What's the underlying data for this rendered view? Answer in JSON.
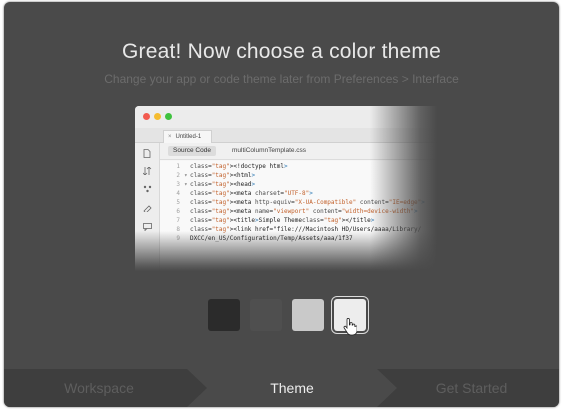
{
  "dialog": {
    "title": "Great! Now choose a color theme",
    "subtitle": "Change your app or code theme later from Preferences > Interface"
  },
  "preview": {
    "tab_close": "×",
    "tab_label": "Untitled-1",
    "source_button": "Source Code",
    "related_file": "multiColumnTemplate.css",
    "code_lines": [
      {
        "n": "1",
        "fold": "",
        "text": "<!doctype html>"
      },
      {
        "n": "2",
        "fold": "▾",
        "text": "<html>"
      },
      {
        "n": "3",
        "fold": "▾",
        "text": "<head>"
      },
      {
        "n": "4",
        "fold": "",
        "text": "<meta charset=\"UTF-8\">"
      },
      {
        "n": "5",
        "fold": "",
        "text": "<meta http-equiv=\"X-UA-Compatible\" content=\"IE=edge\">"
      },
      {
        "n": "6",
        "fold": "",
        "text": "<meta name=\"viewport\" content=\"width=device-width\">"
      },
      {
        "n": "7",
        "fold": "",
        "text": "<title>Simple Theme</title>"
      },
      {
        "n": "8",
        "fold": "",
        "text": "<link href=\"file:///Macintosh HD/Users/aaaa/Library/"
      },
      {
        "n": "9",
        "fold": "",
        "text": "DXCC/en_US/Configuration/Temp/Assets/aaa/1f37"
      }
    ]
  },
  "swatches": [
    {
      "name": "dark",
      "color": "#2b2b2b",
      "selected": false
    },
    {
      "name": "medium-dark",
      "color": "#4f4f4f",
      "selected": false
    },
    {
      "name": "medium-light",
      "color": "#c9c9c9",
      "selected": false
    },
    {
      "name": "light",
      "color": "#ededed",
      "selected": true
    }
  ],
  "steps": {
    "workspace": "Workspace",
    "theme": "Theme",
    "get_started": "Get Started"
  },
  "colors": {
    "dialog_bg": "#4a4a4a",
    "footer_bg": "#3e3e3e",
    "active_step_text": "#ededed",
    "inactive_step_text": "#5e5e5e"
  }
}
